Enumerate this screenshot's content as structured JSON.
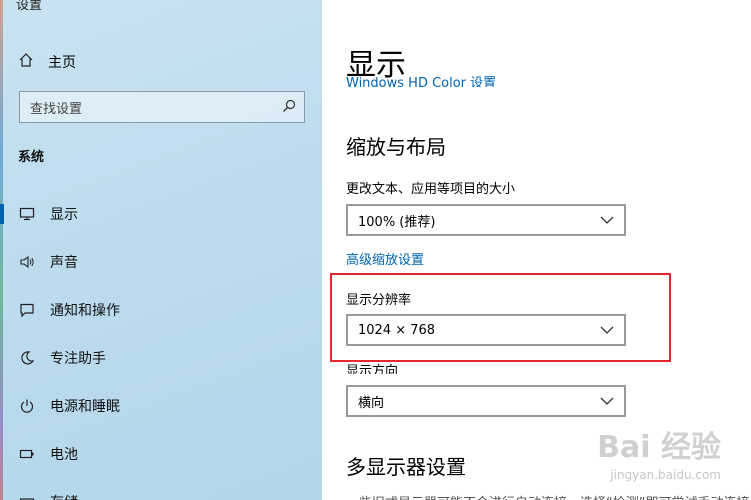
{
  "window": {
    "title": "设置"
  },
  "sidebar": {
    "home_label": "主页",
    "search_placeholder": "查找设置",
    "section_header": "系统",
    "items": [
      {
        "label": "显示",
        "icon": "monitor-icon",
        "active": true
      },
      {
        "label": "声音",
        "icon": "speaker-icon"
      },
      {
        "label": "通知和操作",
        "icon": "notification-icon"
      },
      {
        "label": "专注助手",
        "icon": "moon-icon"
      },
      {
        "label": "电源和睡眠",
        "icon": "power-icon"
      },
      {
        "label": "电池",
        "icon": "battery-icon"
      },
      {
        "label": "存储",
        "icon": "storage-icon"
      }
    ]
  },
  "main": {
    "title": "显示",
    "header_link": "Windows HD Color 设置",
    "scale_section": {
      "heading": "缩放与布局",
      "scale_label": "更改文本、应用等项目的大小",
      "scale_value": "100% (推荐)",
      "advanced_link": "高级缩放设置",
      "resolution_label": "显示分辨率",
      "resolution_value": "1024 × 768",
      "orientation_label": "显示方向",
      "orientation_value": "横向"
    },
    "multi_display": {
      "heading": "多显示器设置",
      "description": "一些旧式显示器可能不会进行自动连接，选择“检测”即可尝试手动连接。"
    }
  },
  "watermark": {
    "brand": "Bai 经验",
    "sub": "jingyan.baidu.com"
  },
  "colors": {
    "accent": "#0063b1",
    "highlight": "#e8262e",
    "sidebar_bg": "#bcdcee"
  }
}
